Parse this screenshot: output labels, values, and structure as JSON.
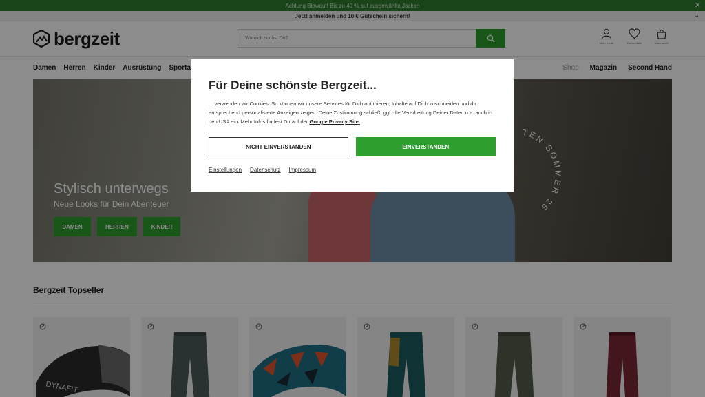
{
  "promo": {
    "text": "Achtung Blowout! Bis zu 40 % auf ausgewählte Jacken",
    "close": "✕"
  },
  "login_bar": {
    "text": "Jetzt anmelden und 10 € Gutschein sichern!",
    "chevron": "⌄"
  },
  "header": {
    "logo_text": "bergzeit",
    "search_placeholder": "Wonach suchst Du?",
    "actions": [
      {
        "icon": "user-icon",
        "label": "Mein Konto"
      },
      {
        "icon": "heart-icon",
        "label": "Wunschliste"
      },
      {
        "icon": "cart-icon",
        "label": "Warenkorb"
      }
    ]
  },
  "nav": {
    "items": [
      "Damen",
      "Herren",
      "Kinder",
      "Ausrüstung",
      "Sportarten"
    ],
    "right": {
      "shop": "Shop",
      "magazin": "Magazin",
      "second_hand": "Second Hand"
    }
  },
  "hero": {
    "title": "Stylisch unterwegs",
    "subtitle": "Neue Looks für Dein Abenteuer",
    "buttons": [
      "DAMEN",
      "HERREN",
      "KINDER"
    ],
    "ring_text": "TEN SOMMER 25"
  },
  "topseller": {
    "title": "Bergzeit Topseller"
  },
  "products": [
    {
      "name": "headband-black",
      "color": "#2a2a2a"
    },
    {
      "name": "pants-grey-teal",
      "color": "#4c5b58"
    },
    {
      "name": "headband-pattern",
      "color": "#1f6f85"
    },
    {
      "name": "pants-teal-ochre",
      "color": "#1d5c60"
    },
    {
      "name": "pants-olive",
      "color": "#555d4c"
    },
    {
      "name": "pants-burgundy",
      "color": "#7a2733"
    }
  ],
  "modal": {
    "title": "Für Deine schönste Bergzeit...",
    "text": "... verwenden wir Cookies. So können wir unsere Services für Dich optimieren, Inhalte auf Dich zuschneiden und dir entsprechend personalisierte Anzeigen zeigen. Deine Zustimmung schließt ggf. die Verarbeitung Deiner Daten u.a. auch in den USA ein. Mehr Infos findest Du auf der",
    "link": "Google Privacy Site.",
    "decline": "NICHT EINVERSTANDEN",
    "accept": "EINVERSTANDEN",
    "links": [
      "Einstellungen",
      "Datenschutz",
      "Impressum"
    ]
  },
  "colors": {
    "brand_green": "#2e9e2e",
    "promo_green": "#2e7d2e"
  }
}
